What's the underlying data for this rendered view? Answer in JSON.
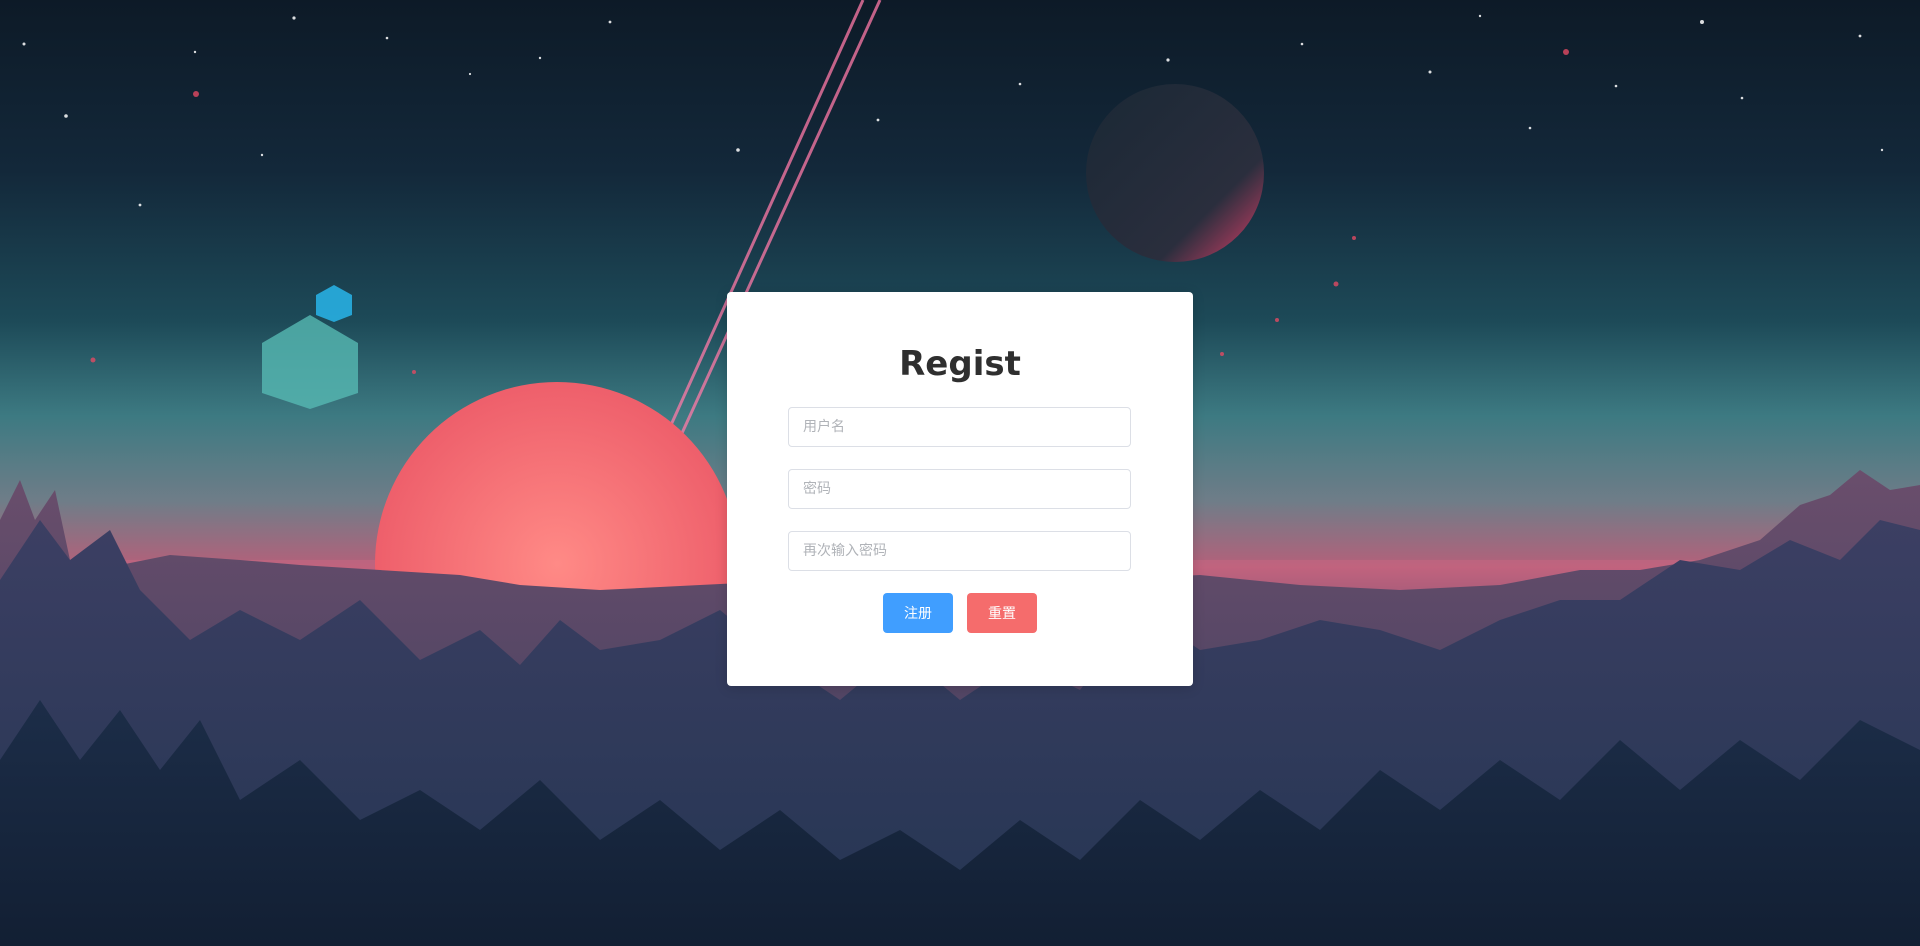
{
  "register_card": {
    "title": "Regist",
    "username_placeholder": "用户名",
    "password_placeholder": "密码",
    "confirm_password_placeholder": "再次输入密码",
    "register_button": "注册",
    "reset_button": "重置"
  },
  "colors": {
    "primary": "#409eff",
    "danger": "#f56c6c",
    "card_background": "#ffffff",
    "title_color": "#2f2f2f"
  }
}
